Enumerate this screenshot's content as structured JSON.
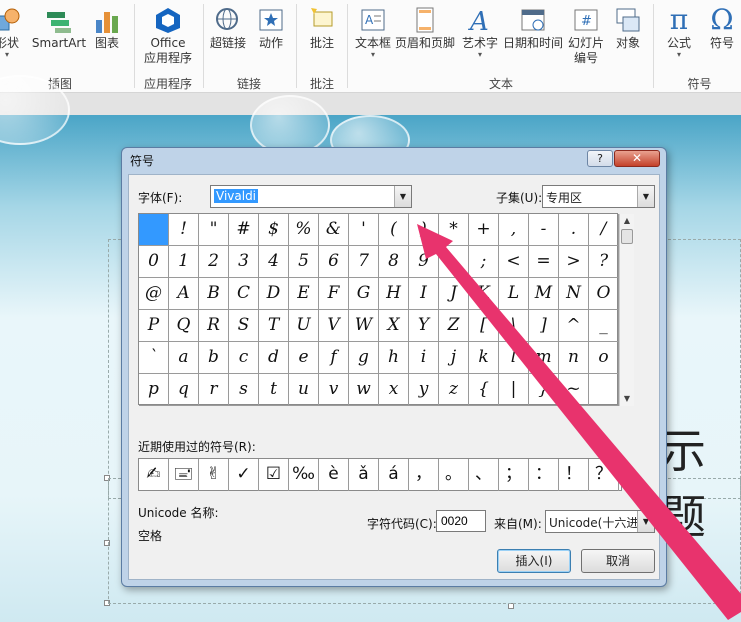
{
  "ribbon": {
    "buttons": [
      {
        "id": "shapes",
        "label": "形状",
        "icon": "shapes-icon"
      },
      {
        "id": "smartart",
        "label": "SmartArt",
        "icon": "smartart-icon"
      },
      {
        "id": "chart",
        "label": "图表",
        "icon": "chart-icon"
      },
      {
        "id": "office-apps",
        "label": "Office",
        "label2": "应用程序",
        "icon": "office-apps-icon"
      },
      {
        "id": "hyperlink",
        "label": "超链接",
        "icon": "hyperlink-icon"
      },
      {
        "id": "action",
        "label": "动作",
        "icon": "action-icon"
      },
      {
        "id": "comment",
        "label": "批注",
        "icon": "comment-icon"
      },
      {
        "id": "textbox",
        "label": "文本框",
        "icon": "textbox-icon"
      },
      {
        "id": "header-footer",
        "label": "页眉和页脚",
        "icon": "header-footer-icon"
      },
      {
        "id": "wordart",
        "label": "艺术字",
        "icon": "wordart-icon"
      },
      {
        "id": "datetime",
        "label": "日期和时间",
        "icon": "calendar-icon"
      },
      {
        "id": "slide-number",
        "label": "幻灯片",
        "label2": "编号",
        "icon": "slide-number-icon"
      },
      {
        "id": "object",
        "label": "对象",
        "icon": "object-icon"
      },
      {
        "id": "equation",
        "label": "公式",
        "icon": "pi-icon",
        "glyph": "π"
      },
      {
        "id": "symbol",
        "label": "符号",
        "icon": "omega-icon",
        "glyph": "Ω"
      }
    ],
    "groups": [
      "插图",
      "应用程序",
      "链接",
      "批注",
      "文本",
      "符号"
    ]
  },
  "slide": {
    "title_fragment": "示题"
  },
  "dialog": {
    "title": "符号",
    "help": "?",
    "close": "✕",
    "font_label": "字体(F):",
    "font_value": "Vivaldi",
    "subset_label": "子集(U):",
    "subset_value": "专用区",
    "symbols": [
      " ",
      "!",
      "\"",
      "#",
      "$",
      "%",
      "&",
      "'",
      "(",
      ")",
      "*",
      "+",
      ",",
      "-",
      ".",
      "/",
      "0",
      "1",
      "2",
      "3",
      "4",
      "5",
      "6",
      "7",
      "8",
      "9",
      ":",
      ";",
      "<",
      "=",
      ">",
      "?",
      "@",
      "A",
      "B",
      "C",
      "D",
      "E",
      "F",
      "G",
      "H",
      "I",
      "J",
      "K",
      "L",
      "M",
      "N",
      "O",
      "P",
      "Q",
      "R",
      "S",
      "T",
      "U",
      "V",
      "W",
      "X",
      "Y",
      "Z",
      "[",
      "\\",
      "]",
      "^",
      "_",
      "`",
      "a",
      "b",
      "c",
      "d",
      "e",
      "f",
      "g",
      "h",
      "i",
      "j",
      "k",
      "l",
      "m",
      "n",
      "o",
      "p",
      "q",
      "r",
      "s",
      "t",
      "u",
      "v",
      "w",
      "x",
      "y",
      "z",
      "{",
      "|",
      "}",
      "~",
      ""
    ],
    "recent_label": "近期使用过的符号(R):",
    "recent": [
      "✍",
      "🖃",
      "✌",
      "✓",
      "☑",
      "‰",
      "è",
      "ǎ",
      "á",
      "，",
      "。",
      "、",
      "；",
      "：",
      "！",
      "？"
    ],
    "unicode_name_label": "Unicode 名称:",
    "unicode_name_value": "空格",
    "char_code_label": "字符代码(C):",
    "char_code_value": "0020",
    "from_label": "来自(M):",
    "from_value": "Unicode(十六进",
    "insert_label": "插入(I)",
    "cancel_label": "取消"
  },
  "colors": {
    "accent": "#3399ff",
    "arrow": "#e8336d"
  }
}
